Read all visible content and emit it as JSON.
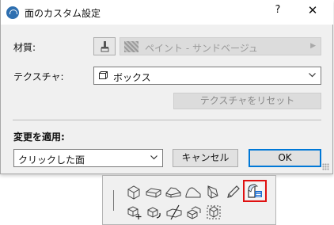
{
  "window": {
    "title": "面のカスタム設定",
    "help": "?",
    "close": "✕"
  },
  "material": {
    "label": "材質:",
    "value": "ペイント - サンドベージュ",
    "brush_icon": "paint-brush-icon"
  },
  "texture": {
    "label": "テクスチャ:",
    "value": "ボックス",
    "icon": "box-icon",
    "reset_label": "テクスチャをリセット"
  },
  "apply": {
    "label": "変更を適用:",
    "value": "クリックした面"
  },
  "buttons": {
    "cancel": "キャンセル",
    "ok": "OK"
  },
  "colors": {
    "accent": "#0078d7",
    "highlight": "#e01010"
  },
  "palette": {
    "top_row": [
      "box-3d-icon",
      "slab-icon",
      "roof-icon",
      "shell-icon",
      "morph-icon",
      "pencil-icon",
      "custom-surface-icon"
    ],
    "bottom_row": [
      "move-node-icon",
      "rotate-icon",
      "split-icon",
      "extrude-icon",
      "select-nodes-icon"
    ],
    "selected": "custom-surface-icon"
  }
}
